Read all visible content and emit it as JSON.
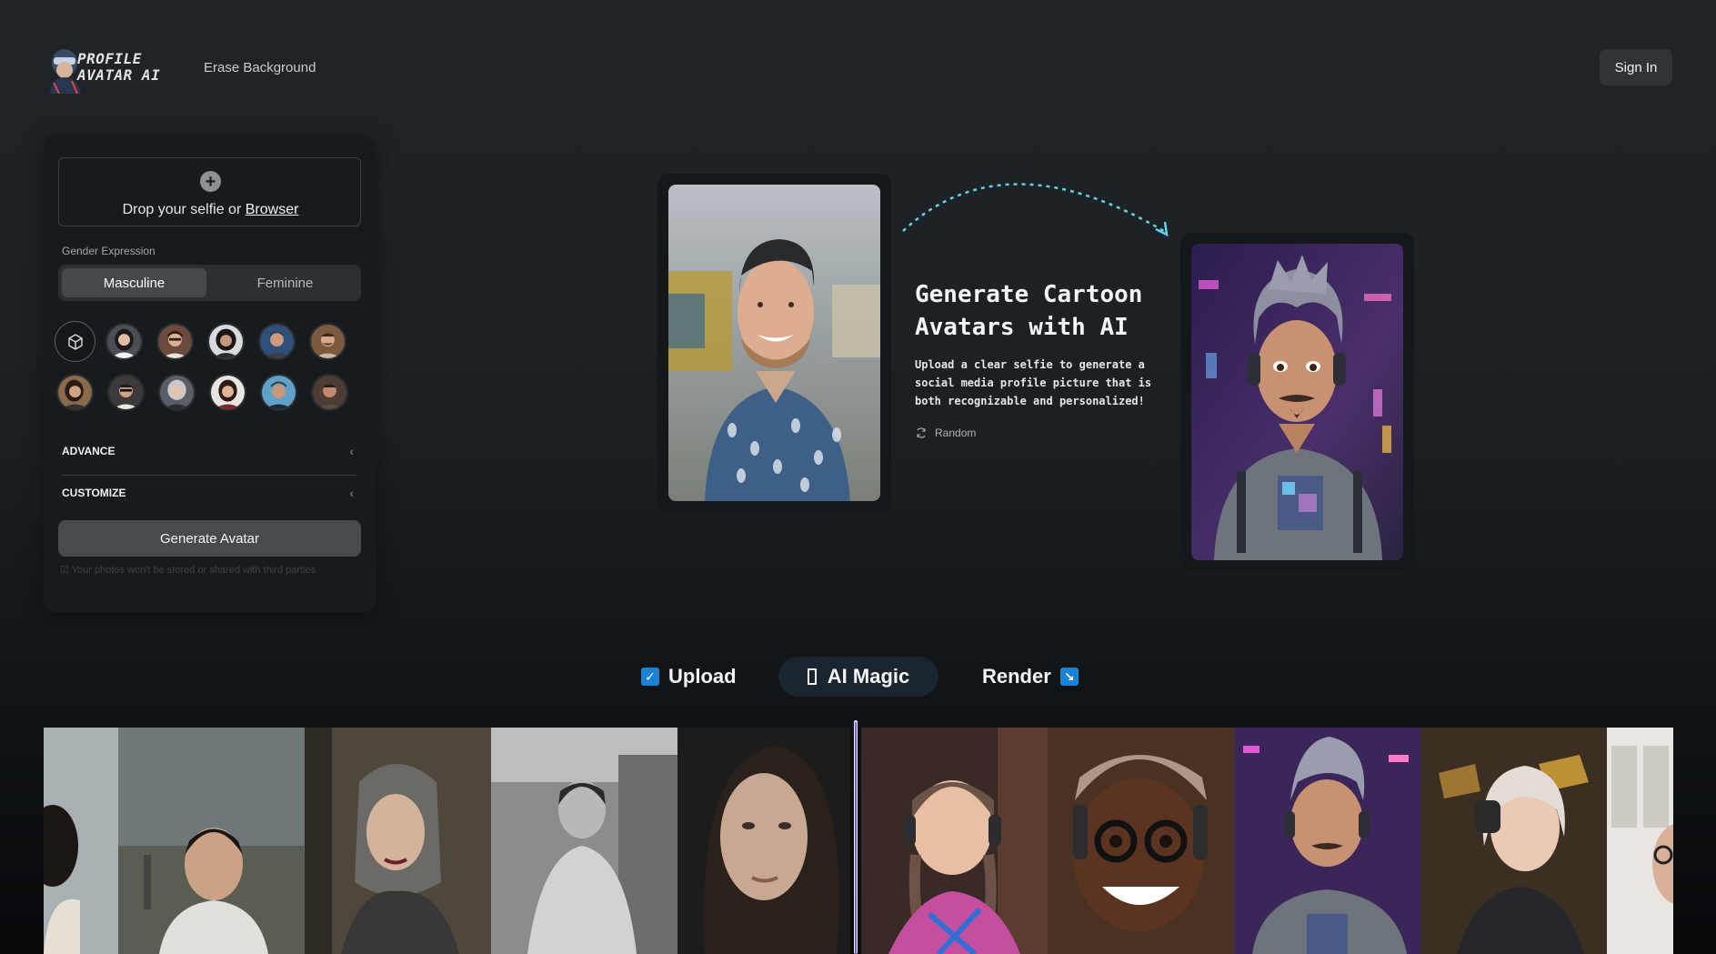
{
  "header": {
    "logo_text": "PROFILE AVATAR AI",
    "nav": {
      "erase_background": "Erase Background"
    },
    "sign_in": "Sign In"
  },
  "panel": {
    "dropzone": {
      "text_prefix": "Drop your selfie or ",
      "browser_link": "Browser"
    },
    "gender_label": "Gender Expression",
    "gender_options": [
      "Masculine",
      "Feminine"
    ],
    "gender_selected": "Masculine",
    "advance_label": "ADVANCE",
    "customize_label": "CUSTOMIZE",
    "generate_label": "Generate Avatar",
    "privacy_note": "Your photos won't be stored or shared with third parties"
  },
  "hero": {
    "title": "Generate Cartoon Avatars with AI",
    "description": "Upload a clear selfie to generate a social media profile picture that is both recognizable and personalized!",
    "random_label": "Random"
  },
  "steps": {
    "upload": "Upload",
    "ai_magic": "AI Magic",
    "render": "Render"
  },
  "colors": {
    "accent_blue": "#1c82d4",
    "divider_purple": "#7b5fd1",
    "arc_cyan": "#5fd3e6"
  }
}
